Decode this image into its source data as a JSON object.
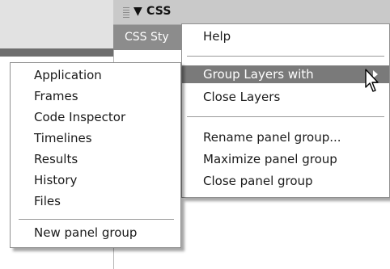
{
  "panel": {
    "title": "CSS",
    "tab_label": "CSS Sty"
  },
  "options_menu": {
    "items": [
      {
        "label": "Help"
      },
      {
        "label": "Group Layers with",
        "has_submenu": true,
        "highlighted": true
      },
      {
        "label": "Close Layers"
      },
      {
        "label": "Rename panel group..."
      },
      {
        "label": "Maximize panel group"
      },
      {
        "label": "Close panel group"
      }
    ]
  },
  "group_submenu": {
    "items": [
      {
        "label": "Application"
      },
      {
        "label": "Frames"
      },
      {
        "label": "Code Inspector"
      },
      {
        "label": "Timelines"
      },
      {
        "label": "Results"
      },
      {
        "label": "History"
      },
      {
        "label": "Files"
      },
      {
        "label": "New panel group"
      }
    ]
  },
  "icons": {
    "collapse": "triangle-down-icon",
    "gripper": "gripper-icon",
    "submenu_arrow": "chevron-right-icon",
    "cursor": "mouse-pointer-icon"
  },
  "colors": {
    "menu_highlight": "#7a7a7a",
    "menu_border": "#8f8f8f",
    "titlebar": "#c9c9c9",
    "tab_active": "#8c8c8c"
  }
}
